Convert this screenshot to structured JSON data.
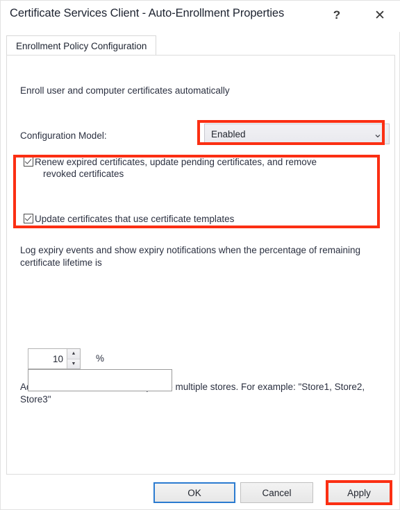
{
  "window": {
    "title": "Certificate Services Client - Auto-Enrollment Properties",
    "help_icon": "question-mark-icon",
    "close_icon": "close-x-icon",
    "help_glyph": "?",
    "close_glyph": "✕"
  },
  "tabs": [
    {
      "label": "Enrollment Policy Configuration",
      "active": true
    }
  ],
  "main": {
    "intro_text": "Enroll user and computer certificates automatically",
    "config_model": {
      "label": "Configuration Model:",
      "value": "Enabled",
      "arrow_glyph": "⌄"
    },
    "checkboxes": [
      {
        "checked": true,
        "line1": "Renew expired certificates, update pending certificates, and remove",
        "line2": "revoked certificates"
      },
      {
        "checked": true,
        "line1": "Update certificates that use certificate templates",
        "line2": ""
      }
    ],
    "expiry": {
      "description": "Log expiry events and show expiry notifications when the percentage of remaining certificate lifetime is",
      "value": "10",
      "unit": "%",
      "spin_up_glyph": "▲",
      "spin_down_glyph": "▼"
    },
    "additional_stores": {
      "description": "Additional stores. Use \",\" to separate multiple stores. For example: \"Store1, Store2, Store3\"",
      "value": "",
      "placeholder": ""
    }
  },
  "footer": {
    "ok_label": "OK",
    "cancel_label": "Cancel",
    "apply_label": "Apply"
  },
  "annotations": {
    "color": "#fb2f13",
    "targets": [
      "configuration-model-dropdown",
      "certificate-checkboxes-group",
      "apply-button"
    ]
  }
}
